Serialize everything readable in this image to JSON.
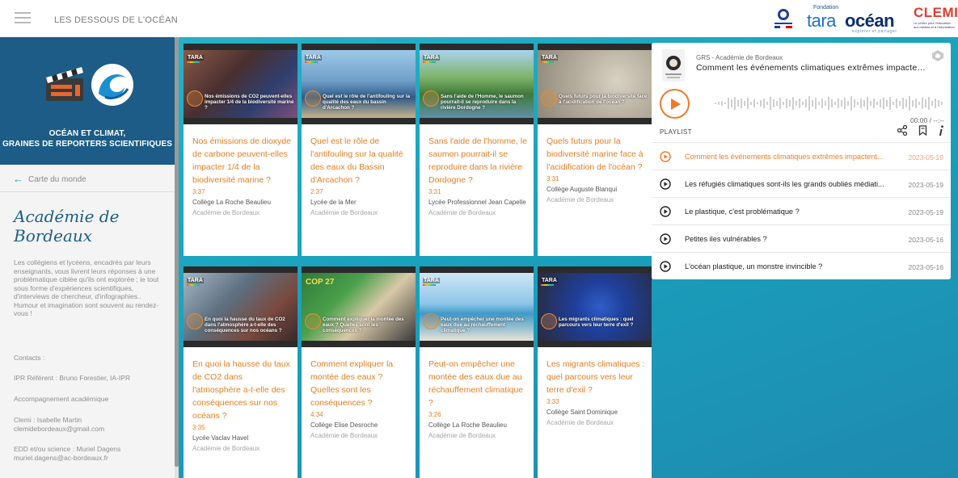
{
  "header": {
    "title": "LES DESSOUS DE L'OCÉAN",
    "logo_fondation": "Fondation",
    "logo_tara": "tara",
    "logo_ocean": "océan",
    "logo_tagline": "explorer et partager",
    "logo_clemi": "CLEMI",
    "logo_clemi_sub": "Le centre pour l'éducation aux médias et à l'information"
  },
  "sidebar": {
    "hero_title_line1": "OCÉAN ET CLIMAT,",
    "hero_title_line2": "GRAINES DE REPORTERS SCIENTIFIQUES",
    "back_link": "Carte du monde",
    "academy_title": "Académie de Bordeaux",
    "description": "Les collégiens et lycéens, encadrés par leurs enseignants, vous livrent leurs réponses à une problématique ciblée qu'ils ont explorée ; le tout sous forme d'expériences scientifiques, d'interviews de chercheur, d'infographies.. Humour et imagination sont souvent au rendez-vous !",
    "contacts_label": "Contacts :",
    "ipr": "IPR Référent : Bruno Forestier, IA-IPR",
    "accompagnement": "Accompagnement académique",
    "clemi_line1": "Clemi : Isabelle Martin",
    "clemi_line2": "clemidebordeaux@gmail.com",
    "edd_line1": "EDD et/ou science : Muriel Dagens",
    "edd_line2": "muriel.dagens@ac-bordeaux.fr"
  },
  "videos": [
    {
      "tara": "TARA",
      "caption": "Nos émissions de CO2 peuvent-elles impacter 1/4 de la biodiversité marine ?",
      "title": "Nos émissions de dioxyde de carbone peuvent-elles impacter 1/4 de la biodiversité marine ?",
      "duration": "3:37",
      "school": "Collège La Roche Beaulieu",
      "academy": "Académie de Bordeaux"
    },
    {
      "tara": "TARA",
      "caption": "Quel est le rôle de l'antifouling sur la qualité des eaux du bassin d'Arcachon ?",
      "title": "Quel est le rôle de l'antifouling sur la qualité des eaux du Bassin d'Arcachon ?",
      "duration": "2:37",
      "school": "Lycée de la Mer",
      "academy": "Académie de Bordeaux"
    },
    {
      "tara": "TARA",
      "caption": "Sans l'aide de l'Homme, le saumon pourrait-il se reproduire dans la rivière Dordogne ?",
      "title": "Sans l'aide de l'homme, le saumon pourrait-il se reproduire dans la rivière Dordogne ?",
      "duration": "3:31",
      "school": "Lycée Professionnel Jean Capelle",
      "academy": "Académie de Bordeaux"
    },
    {
      "tara": "TARA",
      "caption": "Quels futurs pour la biodiversité face à l'acidification de l'océan ?",
      "title": "Quels futurs pour la biodiversité marine face à l'acidification de l'océan ?",
      "duration": "3:31",
      "school": "Collège Auguste Blanqui",
      "academy": "Académie de Bordeaux"
    },
    {
      "tara": "TARA",
      "caption": "En quoi la hausse du taux de CO2 dans l'atmosphère a-t-elle des conséquences sur nos océans ?",
      "title": "En quoi la hausse du taux de CO2 dans l'atmosphère a-t-elle des conséquences sur nos océans ?",
      "duration": "3:35",
      "school": "Lycée Vaclav Havel",
      "academy": "Académie de Bordeaux"
    },
    {
      "tara": "COP 27",
      "caption": "Comment expliquer la montée des eaux ? Quelles sont les conséquences ?",
      "title": "Comment expliquer la montée des eaux ? Quelles sont les conséquences ?",
      "duration": "4:34",
      "school": "Collège Elise Desroche",
      "academy": "Académie de Bordeaux"
    },
    {
      "tara": "TARA",
      "caption": "Peut-on empêcher une montée des eaux due au réchauffement climatique ?",
      "title": "Peut-on empêcher une montée des eaux due au réchauffement climatique ?",
      "duration": "3:26",
      "school": "Collège La Roche Beaulieu",
      "academy": "Académie de Bordeaux"
    },
    {
      "tara": "TARA",
      "caption": "Les migrants climatiques : quel parcours vers leur terre d'exil ?",
      "title": "Les migrants climatiques : quel parcours vers leur terre d'exil ?",
      "duration": "3:33",
      "school": "Collège Saint Dominique",
      "academy": "Académie de Bordeaux"
    }
  ],
  "player": {
    "author": "GRS - Académie de Bordeaux",
    "title": "Comment les événements climatiques extrêmes impactent...",
    "time": "00:00 / --:--",
    "playlist_label": "PLAYLIST",
    "items": [
      {
        "title": "Comment les événements climatiques extrêmes impactent...",
        "date": "2023-05-19"
      },
      {
        "title": "Les réfugiés climatiques sont-ils les grands oubliés médiati...",
        "date": "2023-05-19"
      },
      {
        "title": "Le plastique, c'est problématique ?",
        "date": "2023-05-19"
      },
      {
        "title": "Petites iles vulnérables ?",
        "date": "2023-05-16"
      },
      {
        "title": "L'océan plastique, un monstre invincible ?",
        "date": "2023-05-16"
      }
    ]
  },
  "colors": {
    "teal": "#1aa8c2",
    "navy": "#1d5c86",
    "orange": "#e67e22",
    "player_accent": "#f07a28"
  }
}
